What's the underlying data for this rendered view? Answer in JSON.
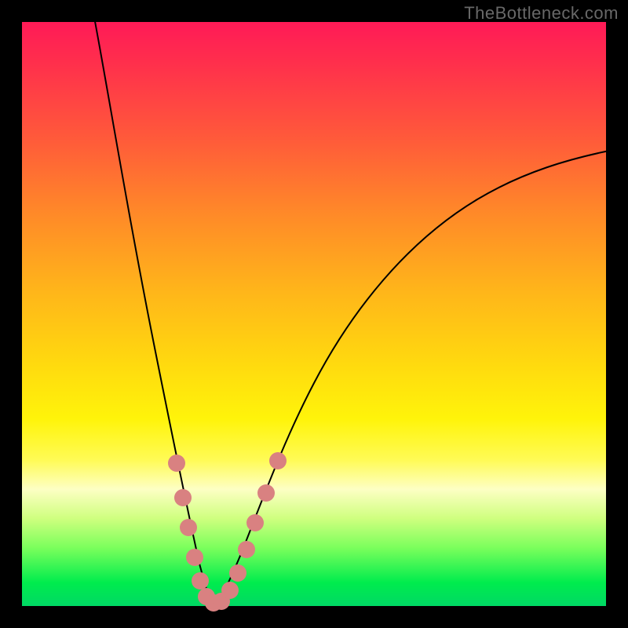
{
  "watermark_text": "TheBottleneck.com",
  "chart_data": {
    "type": "line",
    "title": "",
    "xlabel": "",
    "ylabel": "",
    "xlim": [
      0,
      100
    ],
    "ylim": [
      0,
      100
    ],
    "axes_visible": false,
    "grid": false,
    "background_gradient": {
      "orientation": "vertical",
      "stops": [
        {
          "pos": 0.0,
          "color": "#ff1a57"
        },
        {
          "pos": 0.33,
          "color": "#ff8a28"
        },
        {
          "pos": 0.66,
          "color": "#fff40a"
        },
        {
          "pos": 0.82,
          "color": "#fdffc4"
        },
        {
          "pos": 1.0,
          "color": "#00d864"
        }
      ]
    },
    "series": [
      {
        "name": "left_branch",
        "x": [
          12,
          15,
          18,
          21,
          24,
          26,
          28,
          29.5,
          31,
          32.5
        ],
        "y": [
          100,
          82,
          65,
          49,
          35,
          24,
          15,
          8,
          3,
          0
        ]
      },
      {
        "name": "right_branch",
        "x": [
          32.5,
          34,
          36,
          39,
          43,
          48,
          54,
          61,
          70,
          80,
          90,
          100
        ],
        "y": [
          0,
          4,
          10,
          19,
          31,
          42,
          52,
          60,
          67,
          72,
          76,
          78
        ]
      }
    ],
    "markers": [
      {
        "series": "left_branch",
        "x": 26.2,
        "y": 24.0
      },
      {
        "series": "left_branch",
        "x": 27.4,
        "y": 18.0
      },
      {
        "series": "left_branch",
        "x": 28.4,
        "y": 13.0
      },
      {
        "series": "left_branch",
        "x": 29.4,
        "y": 8.0
      },
      {
        "series": "left_branch",
        "x": 30.4,
        "y": 4.0
      },
      {
        "series": "left_branch",
        "x": 31.4,
        "y": 1.5
      },
      {
        "series": "right_branch",
        "x": 32.5,
        "y": 0.5
      },
      {
        "series": "right_branch",
        "x": 33.8,
        "y": 1.0
      },
      {
        "series": "right_branch",
        "x": 35.2,
        "y": 3.0
      },
      {
        "series": "right_branch",
        "x": 36.6,
        "y": 6.0
      },
      {
        "series": "right_branch",
        "x": 38.0,
        "y": 10.0
      },
      {
        "series": "right_branch",
        "x": 39.6,
        "y": 14.5
      },
      {
        "series": "right_branch",
        "x": 41.4,
        "y": 19.5
      },
      {
        "series": "right_branch",
        "x": 43.4,
        "y": 25.0
      }
    ],
    "marker_style": {
      "shape": "circle",
      "radius_px": 9,
      "color": "#d98181"
    },
    "stroke_color": "#000000",
    "interpretation": "V-shaped bottleneck curve; minimum near x≈32.5, y≈0."
  }
}
